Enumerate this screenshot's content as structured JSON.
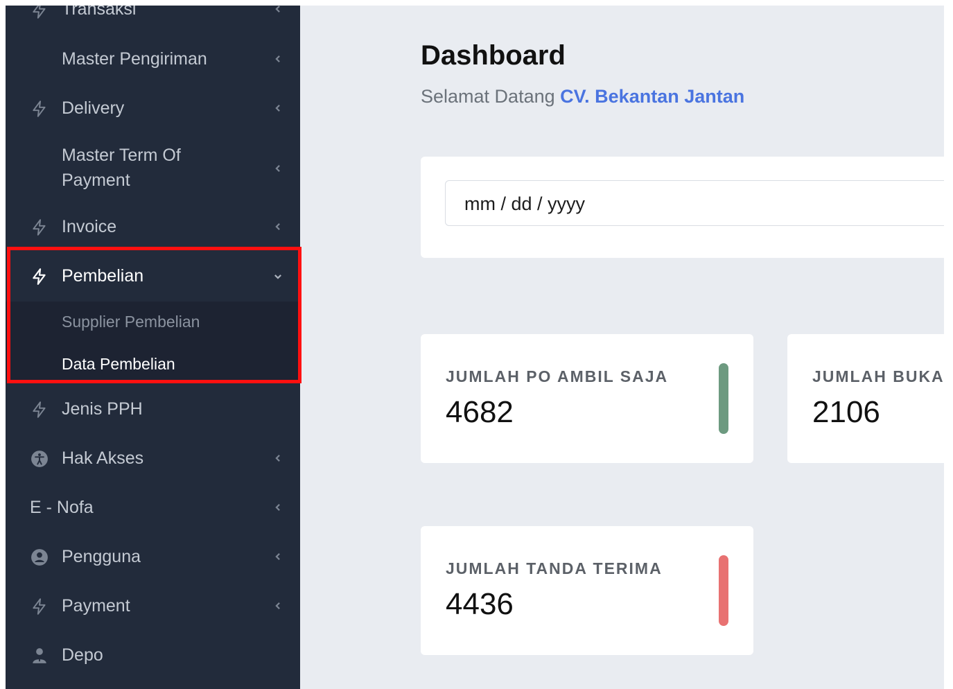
{
  "sidebar": {
    "items": [
      {
        "label": "Transaksi",
        "icon": "bolt-icon"
      },
      {
        "label": "Master Pengiriman",
        "icon": ""
      },
      {
        "label": "Delivery",
        "icon": "bolt-icon"
      },
      {
        "label_line1": "Master Term Of",
        "label_line2": "Payment",
        "icon": ""
      },
      {
        "label": "Invoice",
        "icon": "bolt-icon"
      },
      {
        "label": "Pembelian",
        "icon": "bolt-icon",
        "expanded": true
      },
      {
        "label": "Jenis PPH",
        "icon": "bolt-icon"
      },
      {
        "label": "Hak Akses",
        "icon": "accessibility-icon"
      },
      {
        "label": "E - Nofa",
        "icon": ""
      },
      {
        "label": "Pengguna",
        "icon": "user-circle-icon"
      },
      {
        "label": "Payment",
        "icon": "bolt-icon"
      },
      {
        "label": "Depo",
        "icon": "user-tie-icon"
      }
    ],
    "submenu": [
      {
        "label": "Supplier Pembelian"
      },
      {
        "label": "Data Pembelian",
        "active": true
      }
    ],
    "highlight_color": "#ff1010",
    "background": "#222b3b"
  },
  "main": {
    "title": "Dashboard",
    "welcome_prefix": "Selamat Datang",
    "company": "CV. Bekantan Jantan",
    "date_placeholder": "mm / dd / yyyy",
    "stats": [
      {
        "label": "JUMLAH PO AMBIL SAJA",
        "value": "4682",
        "color": "#6d9a80"
      },
      {
        "label": "JUMLAH BUKA",
        "value": "2106",
        "color": ""
      },
      {
        "label": "JUMLAH TANDA TERIMA",
        "value": "4436",
        "color": "#e87272"
      }
    ]
  }
}
